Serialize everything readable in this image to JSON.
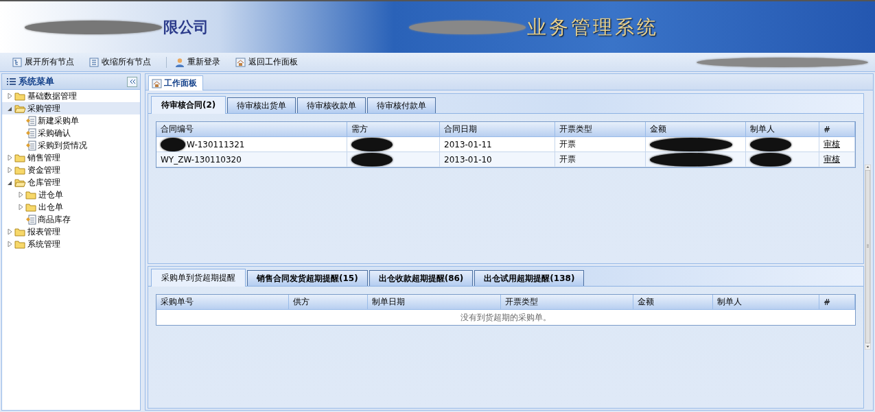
{
  "header": {
    "company_name": "限公司",
    "system_title": "业务管理系统"
  },
  "toolbar": [
    {
      "label": "展开所有节点",
      "kind": "expand"
    },
    {
      "label": "收缩所有节点",
      "kind": "collapse"
    },
    {
      "label": "重新登录",
      "kind": "login"
    },
    {
      "label": "返回工作面板",
      "kind": "home"
    }
  ],
  "sidebar": {
    "title": "系统菜单",
    "items": [
      {
        "label": "基础数据管理",
        "kind": "folder",
        "expanded": false,
        "selected": false
      },
      {
        "label": "采购管理",
        "kind": "folder",
        "expanded": true,
        "selected": true,
        "children": [
          {
            "label": "新建采购单",
            "kind": "page",
            "expanded": false,
            "selected": false
          },
          {
            "label": "采购确认",
            "kind": "page",
            "expanded": false,
            "selected": false
          },
          {
            "label": "采购到货情况",
            "kind": "page",
            "expanded": false,
            "selected": false
          }
        ]
      },
      {
        "label": "销售管理",
        "kind": "folder",
        "expanded": false,
        "selected": false
      },
      {
        "label": "资金管理",
        "kind": "folder",
        "expanded": false,
        "selected": false
      },
      {
        "label": "仓库管理",
        "kind": "folder",
        "expanded": true,
        "selected": false,
        "children": [
          {
            "label": "进仓单",
            "kind": "folder",
            "expanded": false,
            "selected": false
          },
          {
            "label": "出仓单",
            "kind": "folder",
            "expanded": false,
            "selected": false
          },
          {
            "label": "商品库存",
            "kind": "page",
            "expanded": false,
            "selected": false
          }
        ]
      },
      {
        "label": "报表管理",
        "kind": "folder",
        "expanded": false,
        "selected": false
      },
      {
        "label": "系统管理",
        "kind": "folder",
        "expanded": false,
        "selected": false
      }
    ]
  },
  "main_tab": {
    "label": "工作面板",
    "selected": true
  },
  "top_panel": {
    "tabs": [
      {
        "label": "待审核合同(2)",
        "selected": true,
        "bold": true
      },
      {
        "label": "待审核出货单",
        "selected": false,
        "bold": false
      },
      {
        "label": "待审核收款单",
        "selected": false,
        "bold": false
      },
      {
        "label": "待审核付款单",
        "selected": false,
        "bold": false
      }
    ],
    "table": {
      "columns": [
        "合同编号",
        "需方",
        "合同日期",
        "开票类型",
        "金额",
        "制单人",
        "#"
      ],
      "rows": [
        {
          "cells": [
            {
              "text": "W-130111321",
              "redacted": true
            },
            {
              "redacted": true
            },
            {
              "text": "2013-01-11",
              "redacted": false
            },
            {
              "text": "开票",
              "redacted": false
            },
            {
              "redacted": true
            },
            {
              "redacted": true
            }
          ],
          "action": "审核"
        },
        {
          "cells": [
            {
              "text": "WY_ZW-130110320",
              "redacted": false
            },
            {
              "redacted": true
            },
            {
              "text": "2013-01-10",
              "redacted": false
            },
            {
              "text": "开票",
              "redacted": false
            },
            {
              "redacted": true
            },
            {
              "redacted": true
            }
          ],
          "action": "审核"
        }
      ]
    }
  },
  "bottom_panel": {
    "tabs": [
      {
        "label": "采购单到货超期提醒",
        "selected": true,
        "bold": false
      },
      {
        "label": "销售合同发货超期提醒(15)",
        "selected": false,
        "bold": true
      },
      {
        "label": "出仓收款超期提醒(86)",
        "selected": false,
        "bold": true
      },
      {
        "label": "出仓试用超期提醒(138)",
        "selected": false,
        "bold": true
      }
    ],
    "table": {
      "columns": [
        "采购单号",
        "供方",
        "制单日期",
        "开票类型",
        "金额",
        "制单人",
        "#"
      ],
      "empty_message": "没有到货超期的采购单。"
    }
  }
}
